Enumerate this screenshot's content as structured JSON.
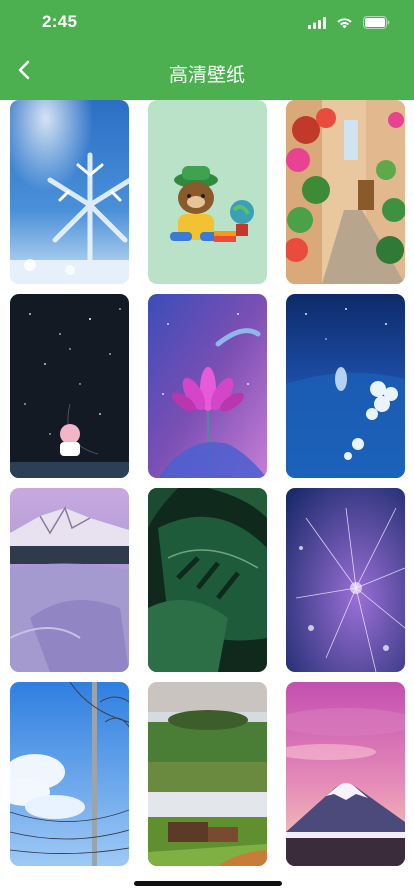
{
  "status_bar": {
    "time": "2:45",
    "icons": [
      "cellular-signal-icon",
      "wifi-icon",
      "battery-icon"
    ]
  },
  "nav": {
    "title": "高清壁纸",
    "back_icon": "chevron-left-icon"
  },
  "colors": {
    "header_green": "#4caf50",
    "background": "#ffffff"
  },
  "wallpapers": [
    {
      "subject": "snowflake"
    },
    {
      "subject": "cartoon-bear"
    },
    {
      "subject": "flower-alley"
    },
    {
      "subject": "night-moon-pig"
    },
    {
      "subject": "lotus"
    },
    {
      "subject": "blue-night-flowers"
    },
    {
      "subject": "snowy-mountain"
    },
    {
      "subject": "monstera-leaf"
    },
    {
      "subject": "dandelion"
    },
    {
      "subject": "sky-power-lines"
    },
    {
      "subject": "countryside"
    },
    {
      "subject": "mount-fuji"
    }
  ]
}
